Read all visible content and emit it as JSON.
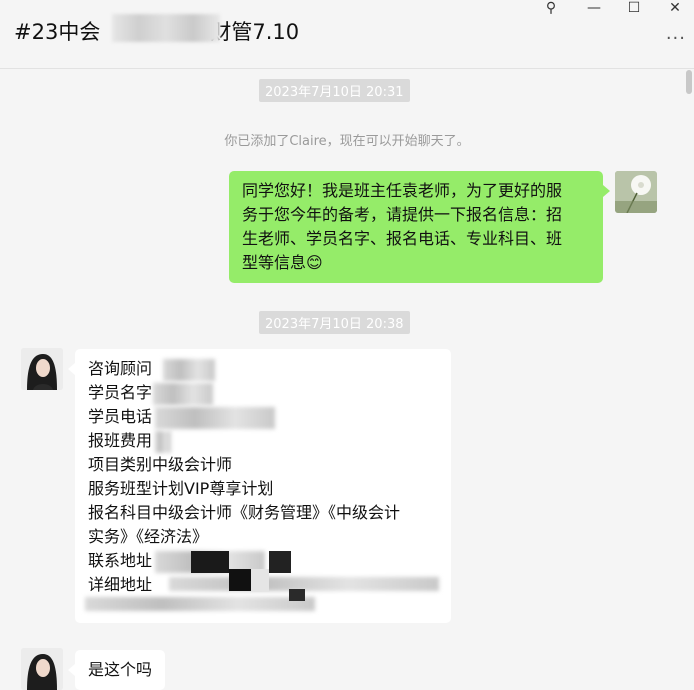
{
  "window": {
    "title": "#23中会",
    "title_suffix": "财管7.10",
    "controls": {
      "pin": "⚲",
      "minimize": "—",
      "maximize": "☐",
      "close": "✕"
    },
    "more": "···"
  },
  "messages": {
    "ts1": "2023年7月10日 20:31",
    "system": "你已添加了Claire，现在可以开始聊天了。",
    "me1": {
      "lines": [
        "同学您好！我是班主任袁老师，为了更好的服",
        "务于您今年的备考，请提供一下报名信息：招",
        "生老师、学员名字、报名电话、专业科目、班",
        "型等信息😊"
      ]
    },
    "ts2": "2023年7月10日 20:38",
    "other1": {
      "lines": [
        "咨询顾问",
        "学员名字",
        "学员电话",
        "报班费用",
        "项目类别中级会计师",
        "服务班型计划VIP尊享计划",
        "报名科目中级会计师《财务管理》《中级会计",
        "实务》《经济法》",
        "联系地址",
        "详细地址"
      ]
    },
    "other2": {
      "text": "是这个吗"
    }
  },
  "icons": {
    "avatar_me": "dandelion-avatar",
    "avatar_other": "woman-portrait-avatar"
  },
  "colors": {
    "me_bubble": "#95ec69",
    "other_bubble": "#ffffff",
    "background": "#f5f5f5"
  }
}
